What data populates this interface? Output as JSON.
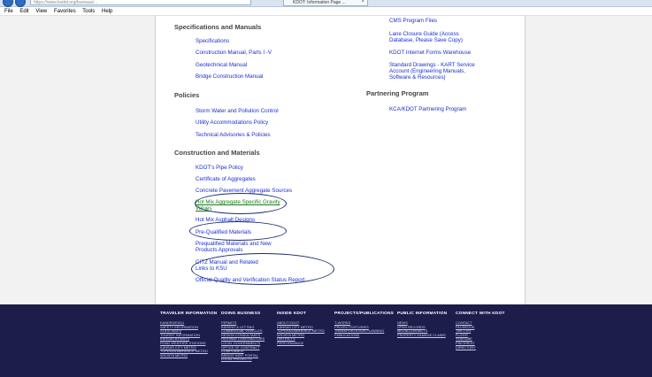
{
  "browser": {
    "address": "https://www.ksdot.org/bureaus/...",
    "tab_title": "KDOT: Information Page ..."
  },
  "menu": [
    "File",
    "Edit",
    "View",
    "Favorites",
    "Tools",
    "Help"
  ],
  "left_col": {
    "spec_heading": "Specifications and Manuals",
    "spec_links": [
      "Specifications",
      "Construction Manual, Parts I -V",
      "Geotechnical Manual",
      "Bridge Construction Manual"
    ],
    "policies_heading": "Policies",
    "policies_links": [
      "Storm Water and Pollution Control",
      "Utility Accommodations Policy",
      "Technical Advisories & Policies"
    ],
    "cm_heading": "Construction and Materials",
    "cm_links": [
      "KDOT's Pipe Policy",
      "Certificate of Aggregates",
      "Concrete Pavement Aggregate Sources",
      "Hot Mix Aggregate Specific Gravity",
      "Values",
      "Hot Mix Asphalt Designs",
      "Pre-Qualified Materials",
      "Prequalified Materials and New",
      "Products Approvals",
      "CITZ Manual and Related",
      "Links to KSU",
      "Official Quality and Verification Status Report"
    ]
  },
  "right_col": {
    "cms": "CMS Program Files",
    "lane_closure": [
      "Lane Closure Guide (Access",
      "Database, Please Save Copy)"
    ],
    "forms": "KDOT Internet Forms Warehouse",
    "standard": [
      "Standard Drawings - KART Service",
      "Account (Engineering Manuals,",
      "Software & Resources)"
    ],
    "partnering_heading": "Partnering Program",
    "partnering_link": "KCA/KDOT Partnering Program"
  },
  "footer": {
    "columns": [
      {
        "heading": "TRAVELER INFORMATION",
        "links": [
          "KANDRIVE/511",
          "SAFETY INFORMATION",
          "STATE MAPS",
          "TOURIST INFORMATION",
          "KANSAS BYWAYS",
          "ROAD WEATHER STATIONS",
          "KANSAS CITY METRO",
          "TOPEKA/LAWRENCE METRO",
          "WICHITA METRO"
        ]
      },
      {
        "heading": "DOING BUSINESS",
        "links": [
          "PERMITS",
          "BIDDING & LETTING",
          "COMMERCIAL VEHICLES",
          "DESIGN CONSULTANTS",
          "HIGHWAY CONTRACTORS",
          "LOCAL GOVERNMENTS",
          "OFFICE OF CONTRACT",
          "COMPLIANCE",
          "BRIDGE INSP. PORTAL",
          "LOCAL PROJECTS"
        ]
      },
      {
        "heading": "INSIDE KDOT",
        "links": [
          "ABOUT KDOT",
          "KANSAS CITY METRO",
          "TOPEKA/LAWRENCE METRO",
          "WICHITA METRO",
          "DISTRICTS",
          "PERFORMANCE"
        ]
      },
      {
        "heading": "PROJECTS/PUBLICATIONS",
        "links": [
          "T-WORKS",
          "PROJECTS/STUDIES",
          "TRANSPORTATION PLANNING",
          "PUBLICATIONS"
        ]
      },
      {
        "heading": "PUBLIC INFORMATION",
        "links": [
          "NEWS",
          "OPEN RECORDS",
          "MEDIA CONTACTS",
          "PROPERTY DAMAGE CLAIMS"
        ]
      },
      {
        "heading": "CONNECT WITH KDOT",
        "links": [
          "CONTACT",
          "FACEBOOK",
          "TWITTER",
          "FLICKR",
          "YOUTUBE",
          "PINTEREST",
          "DIRECTORY"
        ]
      }
    ]
  }
}
